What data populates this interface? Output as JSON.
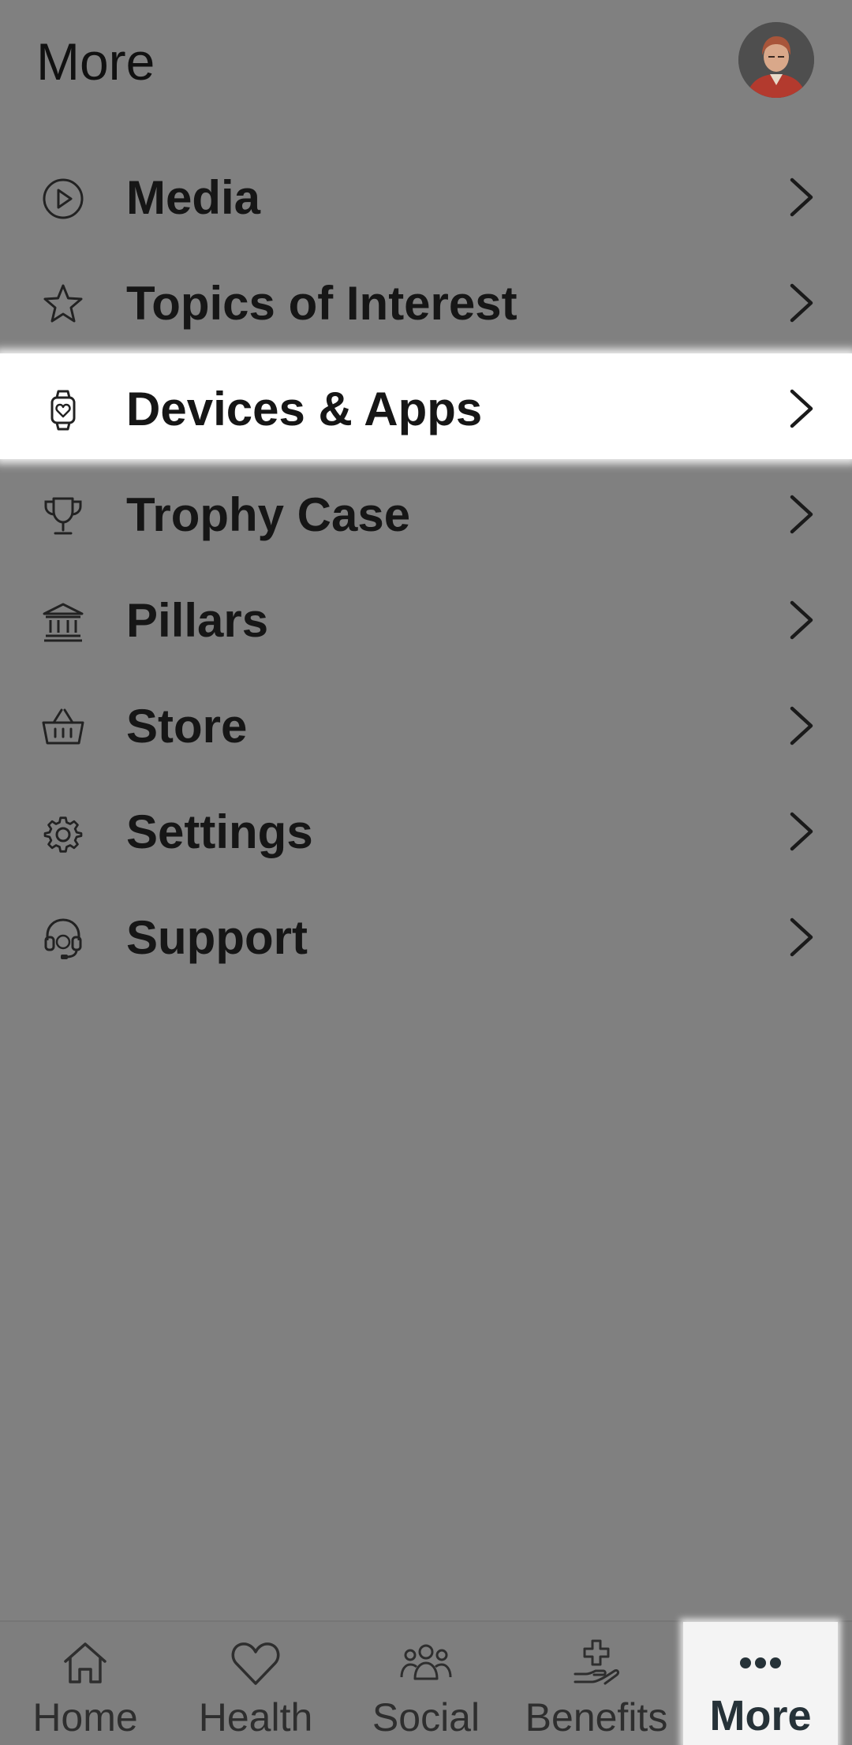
{
  "header": {
    "title": "More",
    "avatar_icon": "user-avatar"
  },
  "menu": {
    "items": [
      {
        "label": "Media",
        "icon": "play-circle-icon"
      },
      {
        "label": "Topics of Interest",
        "icon": "star-icon"
      },
      {
        "label": "Devices & Apps",
        "icon": "smartwatch-icon",
        "highlighted": true
      },
      {
        "label": "Trophy Case",
        "icon": "trophy-icon"
      },
      {
        "label": "Pillars",
        "icon": "pillars-icon"
      },
      {
        "label": "Store",
        "icon": "basket-icon"
      },
      {
        "label": "Settings",
        "icon": "gear-icon"
      },
      {
        "label": "Support",
        "icon": "headset-icon"
      }
    ]
  },
  "bottom_nav": {
    "items": [
      {
        "label": "Home",
        "icon": "home-icon"
      },
      {
        "label": "Health",
        "icon": "heart-icon"
      },
      {
        "label": "Social",
        "icon": "people-icon"
      },
      {
        "label": "Benefits",
        "icon": "hand-plus-icon"
      },
      {
        "label": "More",
        "icon": "more-dots-icon",
        "active": true
      }
    ]
  },
  "colors": {
    "overlay": "#808080",
    "highlight": "#ffffff",
    "text": "#161616",
    "active_nav_text": "#263238"
  }
}
